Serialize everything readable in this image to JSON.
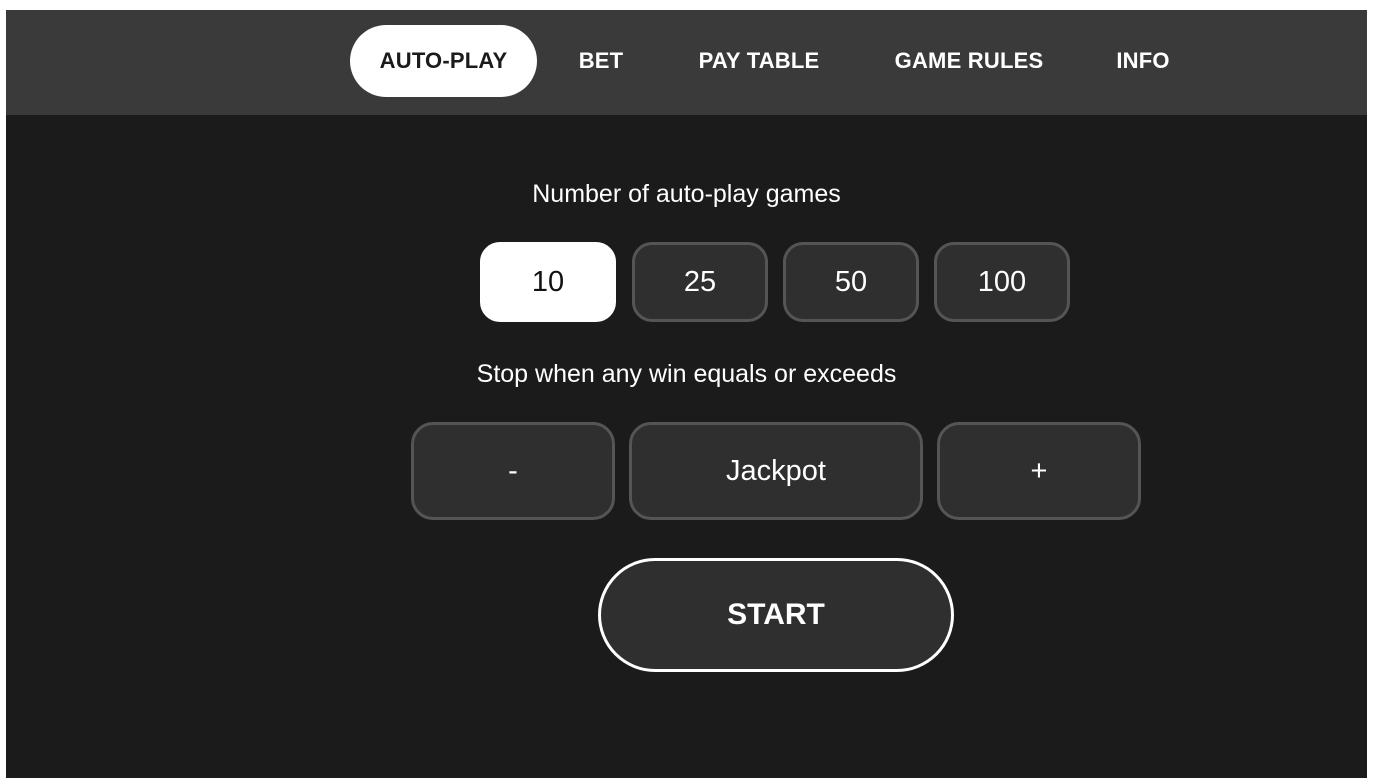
{
  "tabs": [
    {
      "label": "AUTO-PLAY",
      "active": true
    },
    {
      "label": "BET",
      "active": false
    },
    {
      "label": "PAY TABLE",
      "active": false
    },
    {
      "label": "GAME RULES",
      "active": false
    },
    {
      "label": "INFO",
      "active": false
    }
  ],
  "autoplay": {
    "games_label": "Number of auto-play games",
    "game_options": [
      "10",
      "25",
      "50",
      "100"
    ],
    "selected_option": "10",
    "stop_label": "Stop when any win equals or exceeds",
    "decrease_label": "-",
    "stop_value": "Jackpot",
    "increase_label": "+",
    "start_label": "START"
  },
  "colors": {
    "background": "#1b1b1b",
    "nav_background": "#3a3a3a",
    "button_background": "#2f2f2f",
    "button_border": "#555555",
    "active": "#ffffff"
  }
}
